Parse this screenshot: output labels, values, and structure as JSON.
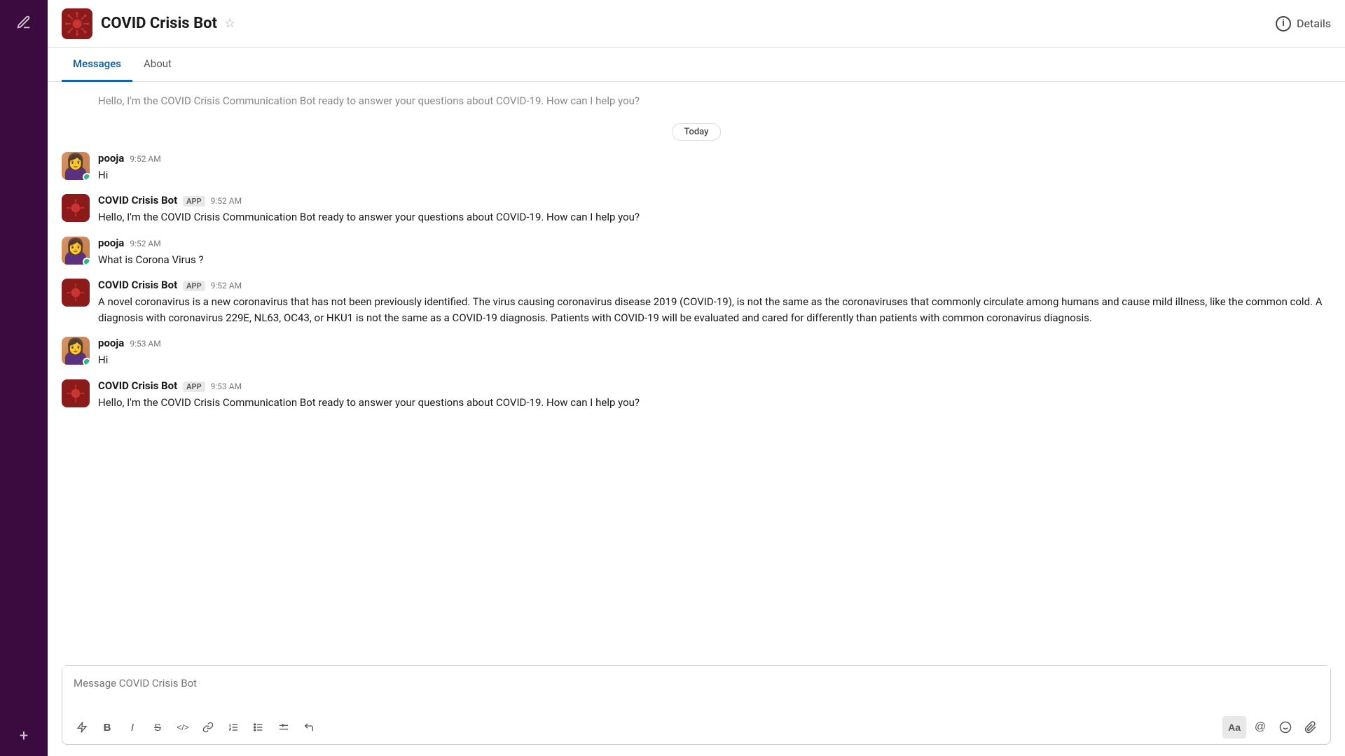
{
  "sidebar": {
    "compose_icon": "✏",
    "add_icon": "+"
  },
  "header": {
    "bot_name": "COVID Crisis Bot",
    "star_icon": "☆",
    "details_label": "Details",
    "info_symbol": "i"
  },
  "tabs": [
    {
      "label": "Messages",
      "active": true
    },
    {
      "label": "About",
      "active": false
    }
  ],
  "messages": {
    "top_faded": "Hello, I'm the COVID Crisis Communication Bot ready to answer your questions about COVID-19. How can I help you?",
    "date_divider": "Today",
    "items": [
      {
        "id": "msg1",
        "type": "user",
        "author": "pooja",
        "time": "9:52 AM",
        "text": "Hi"
      },
      {
        "id": "msg2",
        "type": "bot",
        "author": "COVID Crisis Bot",
        "badge": "APP",
        "time": "9:52 AM",
        "text": "Hello, I'm the COVID Crisis Communication Bot ready to answer your questions about COVID-19. How can I help you?"
      },
      {
        "id": "msg3",
        "type": "user",
        "author": "pooja",
        "time": "9:52 AM",
        "text": "What is Corona Virus ?"
      },
      {
        "id": "msg4",
        "type": "bot",
        "author": "COVID Crisis Bot",
        "badge": "APP",
        "time": "9:52 AM",
        "text": "A novel coronavirus is a new coronavirus that has not been previously identified. The virus causing coronavirus disease 2019 (COVID-19), is not the same as the coronaviruses that commonly circulate among humans and cause mild illness, like the common cold. A diagnosis with coronavirus 229E, NL63, OC43, or HKU1 is not the same as a COVID-19 diagnosis. Patients with COVID-19 will be evaluated and cared for differently than patients with common coronavirus diagnosis."
      },
      {
        "id": "msg5",
        "type": "user",
        "author": "pooja",
        "time": "9:53 AM",
        "text": "Hi"
      },
      {
        "id": "msg6",
        "type": "bot",
        "author": "COVID Crisis Bot",
        "badge": "APP",
        "time": "9:53 AM",
        "text": "Hello, I'm the COVID Crisis Communication Bot ready to answer your questions about COVID-19. How can I help you?"
      }
    ]
  },
  "input": {
    "placeholder": "Message COVID Crisis Bot"
  },
  "toolbar": {
    "aa_label": "Aa",
    "bold": "B",
    "italic": "I",
    "strikethrough": "S",
    "code": "</>",
    "link": "🔗",
    "ordered_list": "≡",
    "bullet_list": "≡",
    "indent": "≡",
    "revert": "↩",
    "mention": "@",
    "emoji": "☺",
    "attachment": "📎"
  }
}
